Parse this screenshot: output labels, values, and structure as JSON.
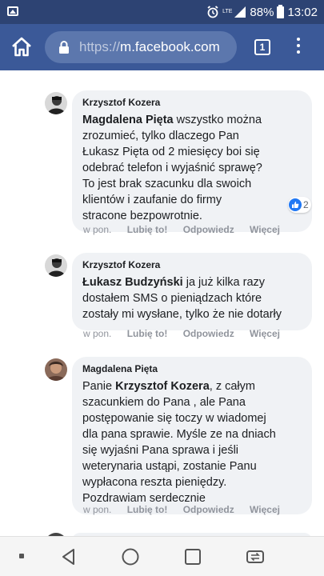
{
  "status_bar": {
    "network": "LTE",
    "battery": "88%",
    "time": "13:02"
  },
  "browser": {
    "url_prefix": "https://",
    "url_domain": "m.facebook.com",
    "tab_count": "1"
  },
  "comments": [
    {
      "author": "Krzysztof Kozera",
      "mention": "Magdalena Pięta",
      "text_lines": [
        " wszystko można",
        "zrozumieć, tylko dlaczego Pan",
        "Łukasz Pięta od 2 miesięcy boi się",
        "odebrać telefon i wyjaśnić sprawę?",
        "To jest brak szacunku dla swoich",
        "klientów i zaufanie do firmy",
        "stracone bezpowrotnie."
      ],
      "reaction_count": "2",
      "time": "w pon.",
      "like_label": "Lubię to!",
      "reply_label": "Odpowiedz",
      "more_label": "Więcej"
    },
    {
      "author": "Krzysztof Kozera",
      "mention": "Łukasz Budzyński",
      "text_lines": [
        " ja już kilka razy",
        "dostałem SMS o pieniądzach które",
        "zostały mi wysłane, tylko że nie dotarły"
      ],
      "time": "w pon.",
      "like_label": "Lubię to!",
      "reply_label": "Odpowiedz",
      "more_label": "Więcej"
    },
    {
      "author": "Magdalena Pięta",
      "prefix": "Panie ",
      "mention": "Krzysztof Kozera",
      "text_lines": [
        ", z całym",
        "szacunkiem do Pana , ale Pana",
        "postępowanie się toczy w wiadomej",
        "dla pana sprawie. Myśle ze na dniach",
        "się wyjaśni Pana sprawa i jeśli",
        "weterynaria ustąpi, zostanie Panu",
        "wypłacona reszta pieniędzy.",
        "Pozdrawiam serdecznie"
      ],
      "time": "w pon.",
      "like_label": "Lubię to!",
      "reply_label": "Odpowiedz",
      "more_label": "Więcej"
    }
  ],
  "colors": {
    "status_bar": "#2d4373",
    "browser_bar": "#3b5998",
    "bubble": "#f0f2f5",
    "like_blue": "#2078f4"
  },
  "icons": [
    "gallery-icon",
    "alarm-icon",
    "lte-signal-icon",
    "battery-icon",
    "home-icon",
    "lock-icon",
    "tabs-icon",
    "menu-icon",
    "like-icon",
    "back-icon",
    "home-circle-icon",
    "recents-icon",
    "screen-switch-icon"
  ]
}
